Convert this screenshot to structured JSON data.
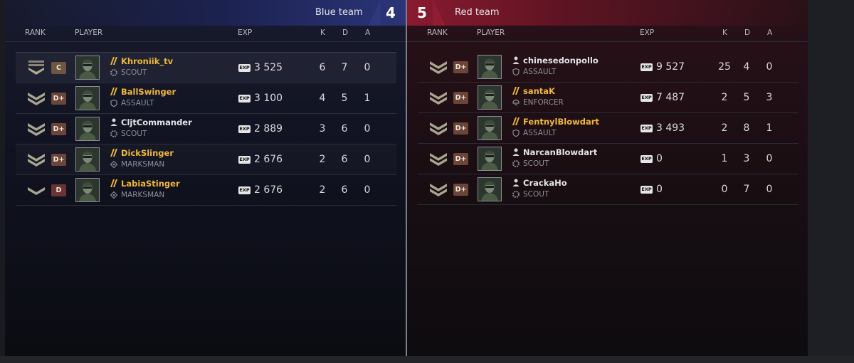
{
  "columns": {
    "rank": "RANK",
    "player": "PLAYER",
    "exp": "EXP",
    "k": "K",
    "d": "D",
    "a": "A"
  },
  "exp_icon_text": "EXP",
  "blue": {
    "name": "Blue team",
    "score": "4",
    "players": [
      {
        "name": "Khroniik_tv",
        "class": "SCOUT",
        "class_icon": "scout-icon",
        "name_icon": "yellow-slash-icon",
        "name_color": "#f0b73a",
        "rank_icon": "rank-chevron-bar-icon",
        "grade": "C",
        "grade_color": "#6e5640",
        "exp": "3 525",
        "k": "6",
        "d": "7",
        "a": "0"
      },
      {
        "name": "BallSwinger",
        "class": "ASSAULT",
        "class_icon": "shield-icon",
        "name_icon": "yellow-slash-icon",
        "name_color": "#f0b73a",
        "rank_icon": "rank-double-chevron-icon",
        "grade": "D+",
        "grade_color": "#6a4538",
        "exp": "3 100",
        "k": "4",
        "d": "5",
        "a": "1"
      },
      {
        "name": "CljtCommander",
        "class": "SCOUT",
        "class_icon": "scout-icon",
        "name_icon": "person-icon",
        "name_color": "#e4e4e6",
        "rank_icon": "rank-double-chevron-icon",
        "grade": "D+",
        "grade_color": "#6a4538",
        "exp": "2 889",
        "k": "3",
        "d": "6",
        "a": "0"
      },
      {
        "name": "DickSlinger",
        "class": "MARKSMAN",
        "class_icon": "crosshair-icon",
        "name_icon": "yellow-slash-icon",
        "name_color": "#f0b73a",
        "rank_icon": "rank-double-chevron-icon",
        "grade": "D+",
        "grade_color": "#6a4538",
        "exp": "2 676",
        "k": "2",
        "d": "6",
        "a": "0"
      },
      {
        "name": "LabiaStinger",
        "class": "MARKSMAN",
        "class_icon": "crosshair-icon",
        "name_icon": "yellow-slash-icon",
        "name_color": "#f0b73a",
        "rank_icon": "rank-single-chevron-icon",
        "grade": "D",
        "grade_color": "#6b3434",
        "exp": "2 676",
        "k": "2",
        "d": "6",
        "a": "0"
      }
    ]
  },
  "red": {
    "name": "Red team",
    "score": "5",
    "players": [
      {
        "name": "chinesedonpollo",
        "class": "ASSAULT",
        "class_icon": "shield-icon",
        "name_icon": "person-icon",
        "name_color": "#e4e4e6",
        "rank_icon": "rank-double-chevron-icon",
        "grade": "D+",
        "grade_color": "#6a4538",
        "exp": "9 527",
        "k": "25",
        "d": "4",
        "a": "0"
      },
      {
        "name": "santaK",
        "class": "ENFORCER",
        "class_icon": "enforcer-icon",
        "name_icon": "yellow-slash-icon",
        "name_color": "#f0b73a",
        "rank_icon": "rank-double-chevron-icon",
        "grade": "D+",
        "grade_color": "#6a4538",
        "exp": "7 487",
        "k": "2",
        "d": "5",
        "a": "3"
      },
      {
        "name": "FentnylBlowdart",
        "class": "ASSAULT",
        "class_icon": "shield-icon",
        "name_icon": "yellow-slash-icon",
        "name_color": "#f0b73a",
        "rank_icon": "rank-double-chevron-icon",
        "grade": "D+",
        "grade_color": "#6a4538",
        "exp": "3 493",
        "k": "2",
        "d": "8",
        "a": "1"
      },
      {
        "name": "NarcanBlowdart",
        "class": "SCOUT",
        "class_icon": "scout-icon",
        "name_icon": "person-icon",
        "name_color": "#e4e4e6",
        "rank_icon": "rank-double-chevron-icon",
        "grade": "D+",
        "grade_color": "#6a4538",
        "exp": "0",
        "k": "1",
        "d": "3",
        "a": "0"
      },
      {
        "name": "CrackaHo",
        "class": "SCOUT",
        "class_icon": "scout-icon",
        "name_icon": "person-icon",
        "name_color": "#e4e4e6",
        "rank_icon": "rank-double-chevron-icon",
        "grade": "D+",
        "grade_color": "#6a4538",
        "exp": "0",
        "k": "0",
        "d": "7",
        "a": "0"
      }
    ]
  }
}
